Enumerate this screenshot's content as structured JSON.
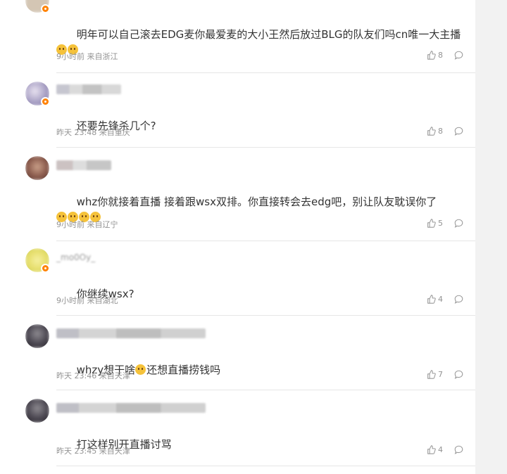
{
  "comments": [
    {
      "username": "",
      "text_before": "明年可以自己滚去EDG麦你最爱麦的大小王然后放过BLG的队友们吗cn唯一大主播",
      "emoji": [
        "smile-emoji",
        "smile-emoji"
      ],
      "text_after": "",
      "meta": "9小时前 来自浙江",
      "likes": "8",
      "avatar_color": "#c9b9a5"
    },
    {
      "username": "",
      "text_before": "还要先锋杀几个?",
      "emoji": [],
      "text_after": "",
      "meta": "昨天 23:48 来自重庆",
      "likes": "8",
      "avatar_color": "#b2a9c8"
    },
    {
      "username": "",
      "text_before": "whz你就接着直播 接着跟wsx双排。你直接转会去edg吧，别让队友耽误你了",
      "emoji": [
        "cry-emoji",
        "cry-emoji",
        "cry-emoji",
        "cry-emoji"
      ],
      "text_after": "",
      "meta": "9小时前 来自辽宁",
      "likes": "5",
      "avatar_color": "#8a5a4c"
    },
    {
      "username": "_mo0Oy_",
      "text_before": "你继续wsx?",
      "emoji": [],
      "text_after": "",
      "meta": "9小时前 来自湖北",
      "likes": "4",
      "avatar_color": "#e8e070"
    },
    {
      "username": "",
      "text_before": "whzy想干啥",
      "emoji": [
        "laugh-emoji"
      ],
      "text_after": "还想直播捞钱吗",
      "meta": "昨天 23:46 来自天津",
      "likes": "7",
      "avatar_color": "#4a4650"
    },
    {
      "username": "",
      "text_before": "打这样别开直播讨骂",
      "emoji": [],
      "text_after": "",
      "meta": "昨天 23:45 来自天津",
      "likes": "4",
      "avatar_color": "#4a4650"
    }
  ],
  "icons": {
    "like": "thumbs-up-icon",
    "reply": "comment-icon"
  },
  "colors": {
    "text": "#333333",
    "meta": "#939393",
    "badge": "#ff8200"
  }
}
